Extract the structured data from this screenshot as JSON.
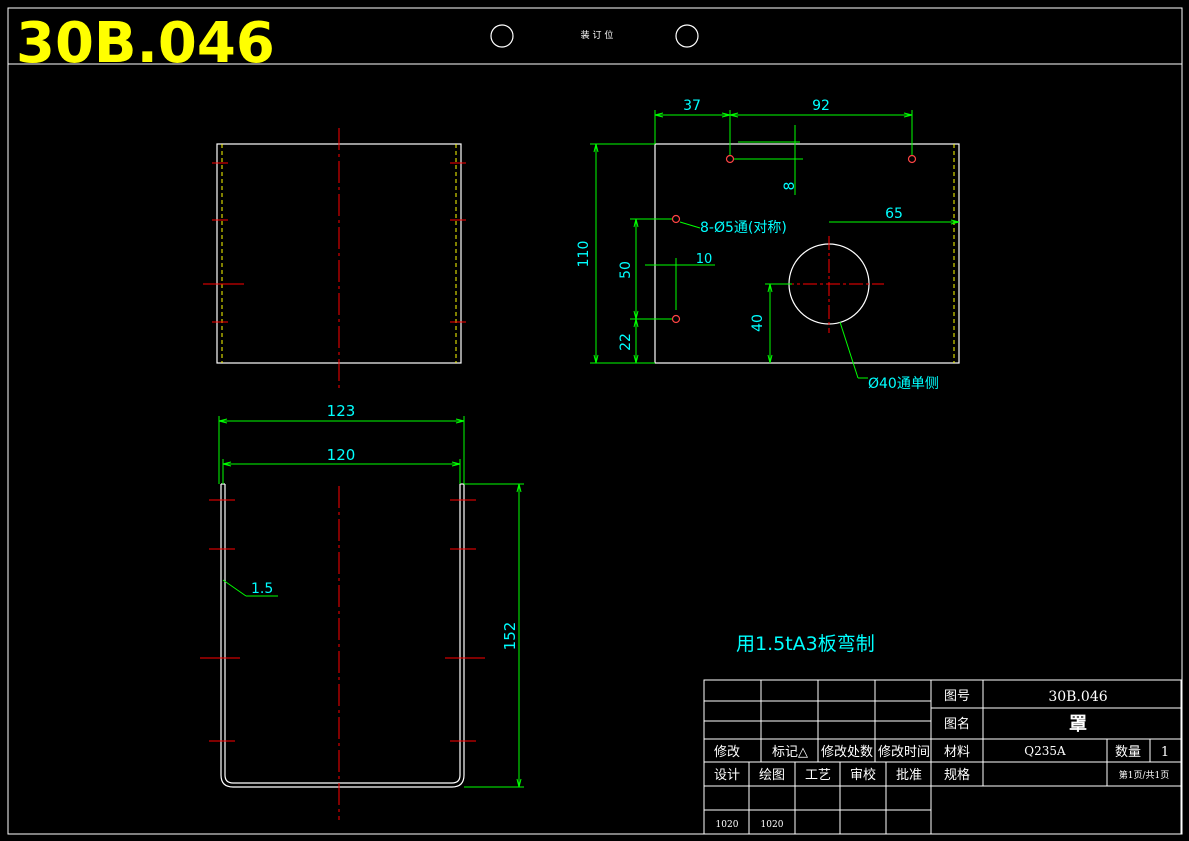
{
  "header": {
    "drawing_code": "30B.046",
    "binding_label": "装 订 位"
  },
  "dimensions": {
    "d37": "37",
    "d92": "92",
    "d8": "8",
    "d65": "65",
    "d110": "110",
    "d50": "50",
    "d10": "10",
    "d22": "22",
    "d40": "40",
    "d123": "123",
    "d120": "120",
    "d152": "152",
    "d1_5": "1.5",
    "holes_note": "8-Ø5通(对称)",
    "big_hole_note": "Ø40通单侧"
  },
  "note": "用1.5tA3板弯制",
  "title_block": {
    "rev_headers": [
      "修改",
      "标记△",
      "修改处数",
      "修改时间"
    ],
    "sign_headers": [
      "设计",
      "绘图",
      "工艺",
      "审校",
      "批准"
    ],
    "sign_values": [
      "1020",
      "1020"
    ],
    "drawing_no_label": "图号",
    "drawing_no": "30B.046",
    "name_label": "图名",
    "name": "罩",
    "material_label": "材料",
    "material": "Q235A",
    "qty_label": "数量",
    "qty": "1",
    "spec_label": "规格",
    "page_info": "第1页/共1页"
  },
  "colors": {
    "outline": "#ffffff",
    "centerline": "#ff0000",
    "dimension_line": "#00ff00",
    "dimension_text": "#00ffff",
    "title_text": "#ffff00",
    "fold_line": "#ffff00"
  }
}
